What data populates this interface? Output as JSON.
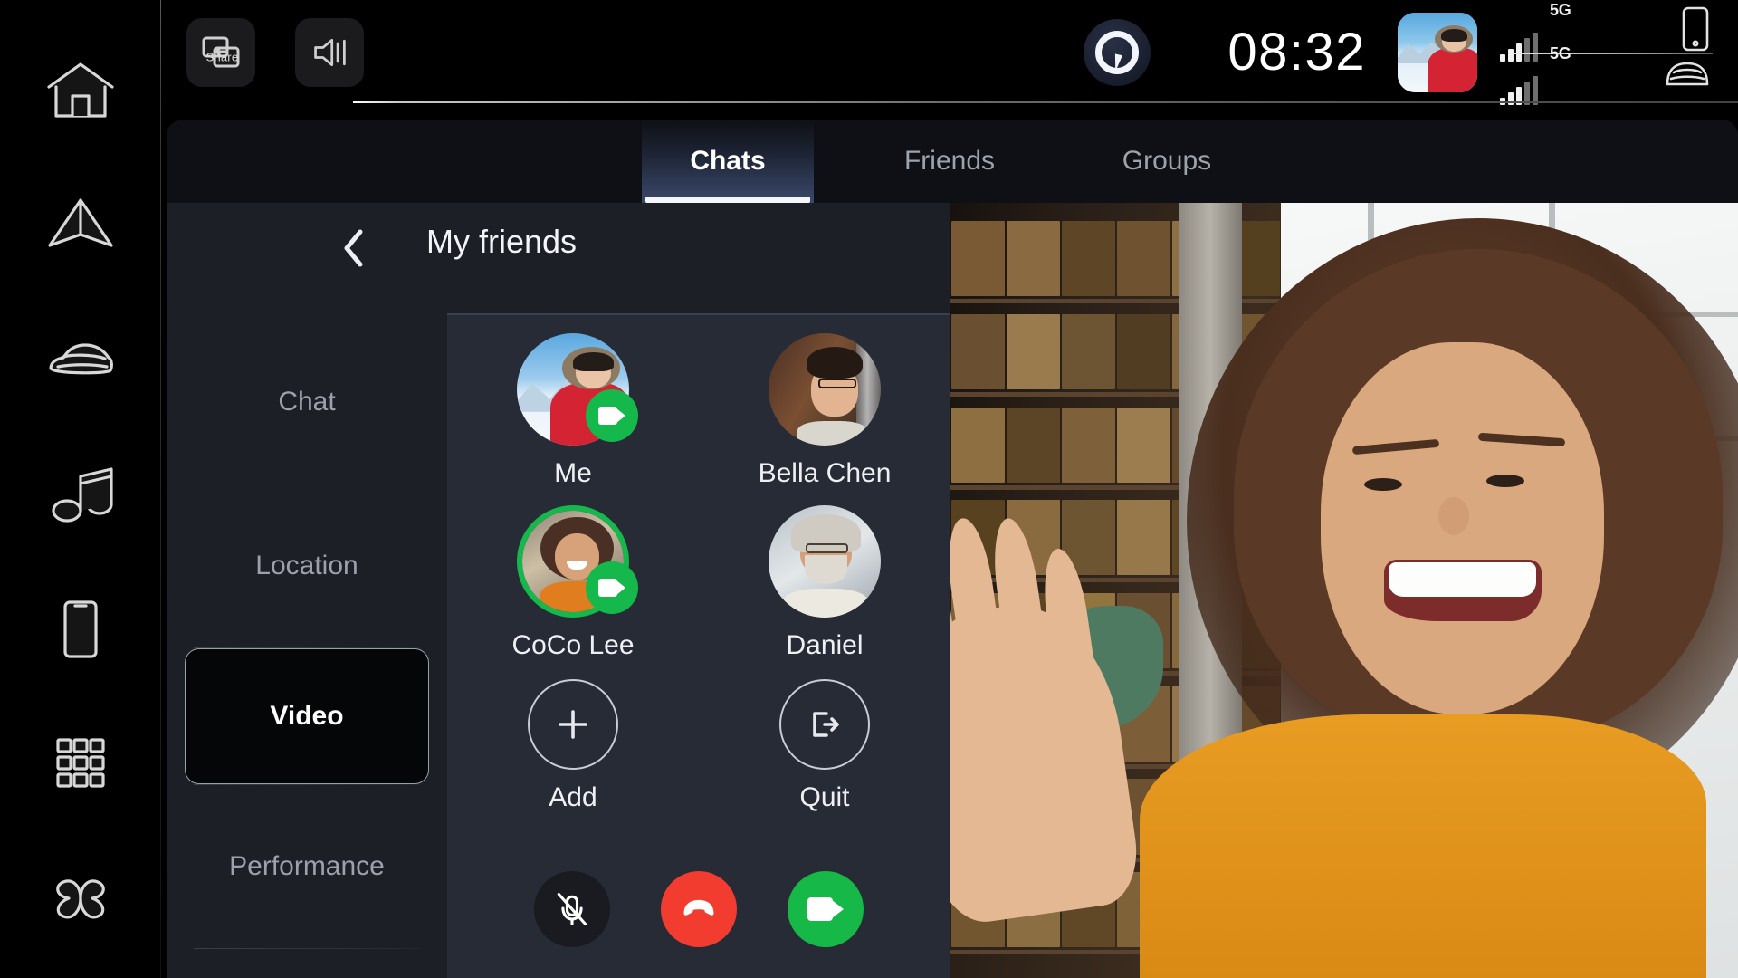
{
  "sidebar": {
    "items": [
      {
        "name": "home",
        "icon": "home-icon"
      },
      {
        "name": "navigation",
        "icon": "navigation-arrow-icon"
      },
      {
        "name": "vehicle",
        "icon": "car-icon"
      },
      {
        "name": "media",
        "icon": "music-note-icon"
      },
      {
        "name": "phone",
        "icon": "phone-icon"
      },
      {
        "name": "apps",
        "icon": "app-grid-icon"
      },
      {
        "name": "climate",
        "icon": "fan-icon"
      }
    ]
  },
  "statusbar": {
    "share_button": {
      "label": "Share",
      "icon": "screen-share-icon"
    },
    "volume_button": {
      "icon": "volume-icon"
    },
    "assistant": {
      "icon": "voice-assistant-icon"
    },
    "clock": "08:32",
    "avatar": {
      "icon": "user-avatar"
    },
    "signals": [
      {
        "network": "5G",
        "device": "phone",
        "device_icon": "smartphone-icon",
        "bars": 3,
        "bars_total": 5
      },
      {
        "network": "5G",
        "device": "car",
        "device_icon": "car-front-icon",
        "bars": 3,
        "bars_total": 5
      }
    ]
  },
  "tabs": [
    {
      "label": "Chats",
      "active": true
    },
    {
      "label": "Friends",
      "active": false
    },
    {
      "label": "Groups",
      "active": false
    }
  ],
  "content": {
    "back_label": "Back",
    "title": "My friends",
    "menu": [
      {
        "label": "Chat",
        "selected": false
      },
      {
        "label": "Location",
        "selected": false
      },
      {
        "label": "Video",
        "selected": true
      },
      {
        "label": "Performance",
        "selected": false
      }
    ]
  },
  "participants": [
    {
      "name": "Me",
      "video_on": true,
      "speaking": false,
      "avatar": "avatar-me"
    },
    {
      "name": "Bella Chen",
      "video_on": false,
      "speaking": false,
      "avatar": "avatar-bella"
    },
    {
      "name": "CoCo Lee",
      "video_on": true,
      "speaking": true,
      "avatar": "avatar-coco"
    },
    {
      "name": "Daniel",
      "video_on": false,
      "speaking": false,
      "avatar": "avatar-daniel"
    }
  ],
  "actions": [
    {
      "label": "Add",
      "icon": "plus-icon"
    },
    {
      "label": "Quit",
      "icon": "exit-icon"
    }
  ],
  "call_controls": [
    {
      "name": "microphone",
      "icon": "mic-muted-icon",
      "state": "muted",
      "color": "#191b20"
    },
    {
      "name": "end-call",
      "icon": "hangup-icon",
      "state": "active",
      "color": "#f23c30"
    },
    {
      "name": "camera",
      "icon": "video-camera-icon",
      "state": "on",
      "color": "#16b848"
    }
  ],
  "video_feed": {
    "label": "CoCo Lee video stream"
  },
  "colors": {
    "accent_green": "#16b848",
    "accent_red": "#f23c30",
    "panel_bg": "#1c1f26",
    "panel_inner_bg": "#272b36",
    "tab_active_grad": "#3b4a6c",
    "text_primary": "#f2f4f8",
    "text_muted": "#9da1ab"
  }
}
